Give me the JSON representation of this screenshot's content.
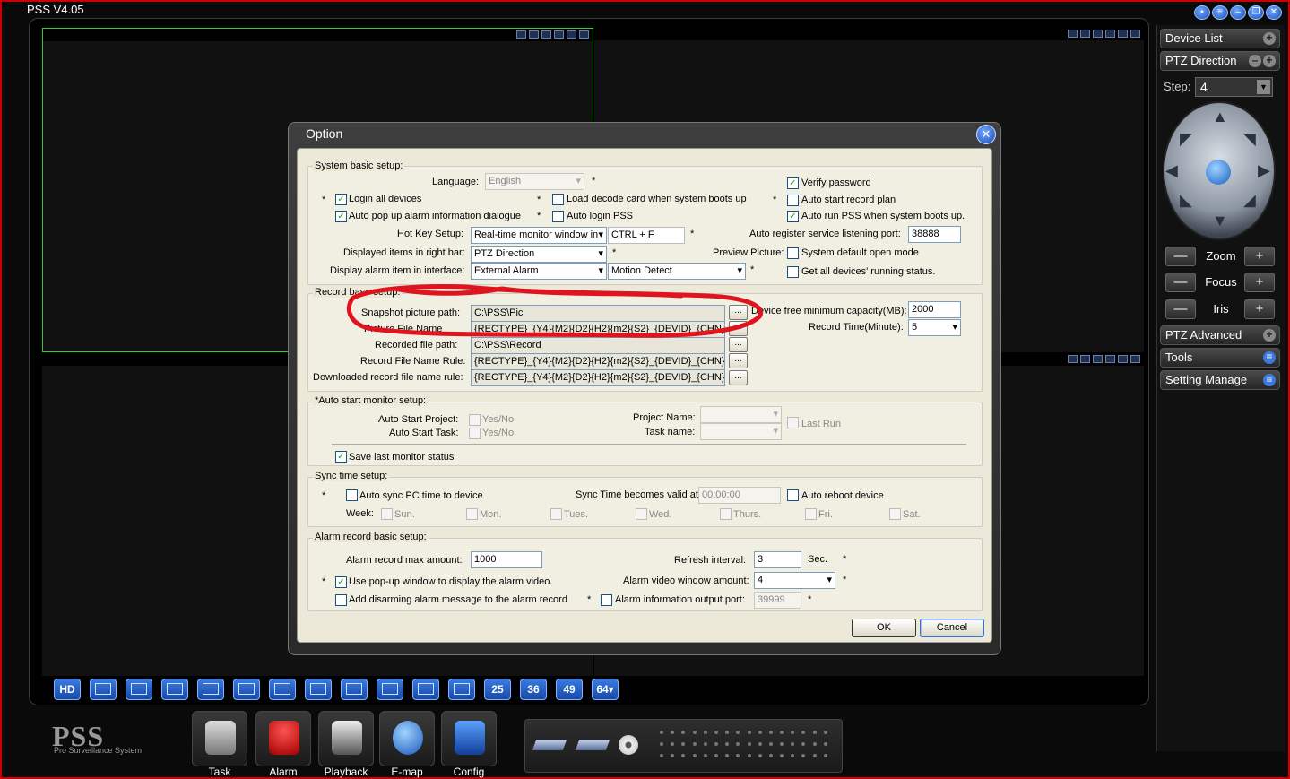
{
  "app": {
    "title": "PSS  V4.05",
    "pane_icon_count": 6
  },
  "sidebar": {
    "device_list": "Device List",
    "ptz_direction": "PTZ Direction",
    "step_label": "Step:",
    "step_value": "4",
    "zoom": "Zoom",
    "focus": "Focus",
    "iris": "Iris",
    "minus": "—",
    "plus": "+",
    "ptz_advanced": "PTZ Advanced",
    "tools": "Tools",
    "setting_manage": "Setting Manage"
  },
  "layout_bar": [
    "HD",
    "",
    "",
    "",
    "",
    "",
    "",
    "",
    "",
    "",
    "",
    "",
    "25",
    "36",
    "49",
    "64▾"
  ],
  "taskbar": {
    "logo": "PSS",
    "logo_sub": "Pro Surveillance System",
    "items": [
      "Task",
      "Alarm",
      "Playback",
      "E-map",
      "Config"
    ]
  },
  "dialog": {
    "title": "Option",
    "system": {
      "title": "System basic setup:",
      "language_label": "Language:",
      "language_value": "English",
      "verify_password": "Verify password",
      "login_all_devices": "Login all devices",
      "load_decode_card": "Load decode card when system boots up",
      "auto_start_record_plan": "Auto start record plan",
      "auto_popup_alarm": "Auto pop up alarm information dialogue",
      "auto_login_pss": "Auto login PSS",
      "auto_run_pss": "Auto run PSS when system boots up.",
      "hotkey_label": "Hot Key Setup:",
      "hotkey_value": "Real-time monitor window in",
      "hotkey_combo": "CTRL  + F",
      "auto_register_label": "Auto register service listening port:",
      "auto_register_port": "38888",
      "displayed_items_label": "Displayed items in right bar:",
      "displayed_items_value": "PTZ Direction",
      "preview_picture_label": "Preview Picture:",
      "system_default_open_mode": "System default open mode",
      "display_alarm_label": "Display alarm item in interface:",
      "display_alarm_value": "External Alarm",
      "motion_detect_value": "Motion Detect",
      "get_all_devices_status": "Get all devices' running status."
    },
    "record": {
      "title": "Record base setup:",
      "snapshot_label": "Snapshot picture path:",
      "snapshot_value": "C:\\PSS\\Pic",
      "picture_name_label": "Picture File Name",
      "picture_name_value": "{RECTYPE}_{Y4}{M2}{D2}{H2}{m2}{S2}_{DEVID}_{CHN}",
      "device_free_label": "Device free minimum capacity(MB):",
      "device_free_value": "2000",
      "record_time_label": "Record Time(Minute):",
      "record_time_value": "5",
      "recorded_path_label": "Recorded file  path:",
      "recorded_path_value": "C:\\PSS\\Record",
      "record_name_rule_label": "Record File Name Rule:",
      "record_name_rule_value": "{RECTYPE}_{Y4}{M2}{D2}{H2}{m2}{S2}_{DEVID}_{CHN}",
      "downloaded_rule_label": "Downloaded record file name rule:",
      "downloaded_rule_value": "{RECTYPE}_{Y4}{M2}{D2}{H2}{m2}{S2}_{DEVID}_{CHN}",
      "browse": "..."
    },
    "monitor": {
      "title": "*Auto start monitor setup:",
      "auto_start_project_label": "Auto Start Project:",
      "auto_start_task_label": "Auto Start Task:",
      "yes_no": "Yes/No",
      "project_name_label": "Project Name:",
      "task_name_label": "Task name:",
      "last_run": "Last Run",
      "save_last_monitor": "Save last monitor status"
    },
    "sync": {
      "title": "Sync time setup:",
      "auto_sync": "Auto sync PC time to device",
      "sync_valid_label": "Sync Time becomes valid at:",
      "sync_time_value": "00:00:00",
      "auto_reboot": "Auto reboot device",
      "week_label": "Week:",
      "days": [
        "Sun.",
        "Mon.",
        "Tues.",
        "Wed.",
        "Thurs.",
        "Fri.",
        "Sat."
      ]
    },
    "alarm": {
      "title": "Alarm record basic setup:",
      "max_amount_label": "Alarm record max amount:",
      "max_amount_value": "1000",
      "refresh_label": "Refresh interval:",
      "refresh_value": "3",
      "refresh_unit": "Sec.",
      "use_popup": "Use pop-up window to display the alarm video.",
      "window_amount_label": "Alarm video window amount:",
      "window_amount_value": "4",
      "add_disarming": "Add disarming alarm message to the alarm record",
      "output_port_label": "Alarm information output port:",
      "output_port_value": "39999"
    },
    "star": "*",
    "ok": "OK",
    "cancel": "Cancel"
  },
  "colors": {
    "accent_blue": "#1c4fb8",
    "annotation_red": "#e0141e",
    "selected_pane_border": "#2cd12c"
  }
}
